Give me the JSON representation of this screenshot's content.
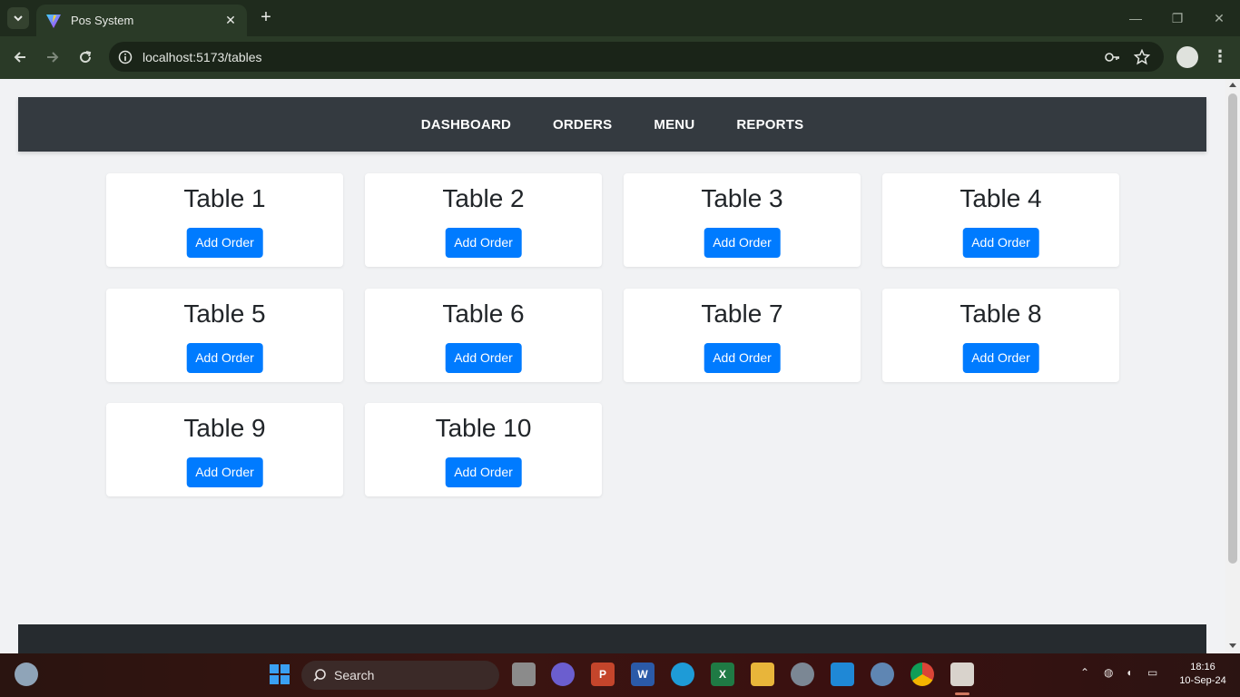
{
  "browser": {
    "tab_title": "Pos System",
    "tab_close": "✕",
    "new_tab": "+",
    "url": "localhost:5173/tables",
    "window_controls": {
      "minimize": "—",
      "restore": "❐",
      "close": "✕"
    },
    "menu": "⋮"
  },
  "nav": {
    "items": [
      "DASHBOARD",
      "ORDERS",
      "MENU",
      "REPORTS"
    ]
  },
  "tables": [
    {
      "name": "Table 1",
      "button": "Add Order"
    },
    {
      "name": "Table 2",
      "button": "Add Order"
    },
    {
      "name": "Table 3",
      "button": "Add Order"
    },
    {
      "name": "Table 4",
      "button": "Add Order"
    },
    {
      "name": "Table 5",
      "button": "Add Order"
    },
    {
      "name": "Table 6",
      "button": "Add Order"
    },
    {
      "name": "Table 7",
      "button": "Add Order"
    },
    {
      "name": "Table 8",
      "button": "Add Order"
    },
    {
      "name": "Table 9",
      "button": "Add Order"
    },
    {
      "name": "Table 10",
      "button": "Add Order"
    }
  ],
  "taskbar": {
    "search_label": "Search",
    "time": "18:16",
    "date": "10-Sep-24"
  },
  "colors": {
    "nav_bg": "#343a40",
    "button_primary": "#007bff",
    "page_bg": "#f1f2f4",
    "browser_frame": "#2a3a27"
  }
}
